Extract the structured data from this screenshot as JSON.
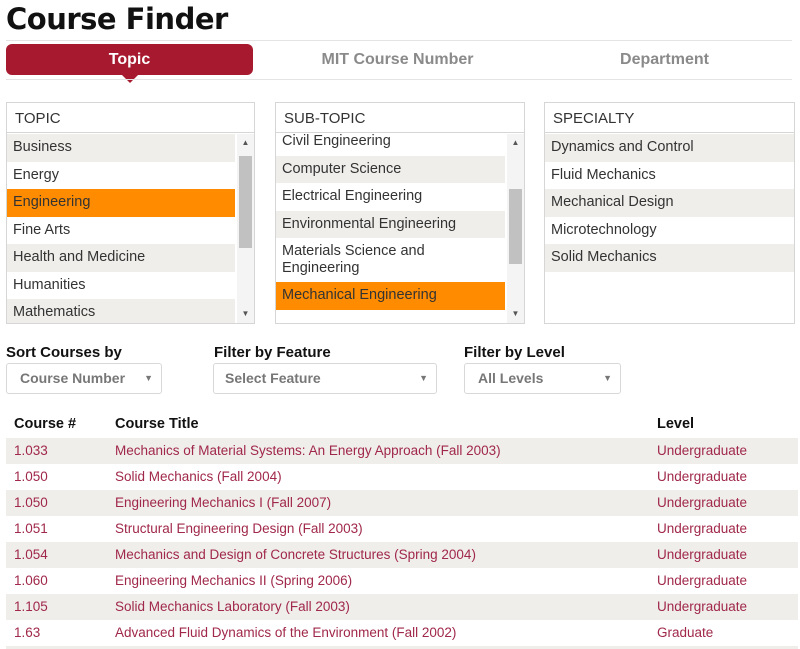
{
  "page": {
    "title": "Course Finder"
  },
  "tabs": [
    {
      "label": "Topic",
      "active": true
    },
    {
      "label": "MIT Course Number",
      "active": false
    },
    {
      "label": "Department",
      "active": false
    }
  ],
  "colors": {
    "accent": "#a6192e",
    "selected": "#ff8c00",
    "link": "#a0284a",
    "alt_row": "#f0eeeb"
  },
  "topic": {
    "header": "TOPIC",
    "items": [
      "Business",
      "Energy",
      "Engineering",
      "Fine Arts",
      "Health and Medicine",
      "Humanities",
      "Mathematics"
    ],
    "selected": "Engineering"
  },
  "subtopic": {
    "header": "SUB-TOPIC",
    "items": [
      "Civil Engineering",
      "Computer Science",
      "Electrical Engineering",
      "Environmental Engineering",
      "Materials Science and Engineering",
      "Mechanical Engineering"
    ],
    "selected": "Mechanical Engineering"
  },
  "specialty": {
    "header": "SPECIALTY",
    "items": [
      "Dynamics and Control",
      "Fluid Mechanics",
      "Mechanical Design",
      "Microtechnology",
      "Solid Mechanics"
    ]
  },
  "filters": {
    "sort": {
      "label": "Sort Courses by",
      "value": "Course Number"
    },
    "feature": {
      "label": "Filter by Feature",
      "value": "Select Feature"
    },
    "level": {
      "label": "Filter by Level",
      "value": "All Levels"
    }
  },
  "icons": {
    "caret": "▼",
    "scroll_up": "▲",
    "scroll_down": "▼"
  },
  "results": {
    "columns": {
      "number": "Course #",
      "title": "Course Title",
      "level": "Level"
    },
    "rows": [
      {
        "number": "1.033",
        "title": "Mechanics of Material Systems: An Energy Approach (Fall 2003)",
        "level": "Undergraduate"
      },
      {
        "number": "1.050",
        "title": "Solid Mechanics (Fall 2004)",
        "level": "Undergraduate"
      },
      {
        "number": "1.050",
        "title": "Engineering Mechanics I (Fall 2007)",
        "level": "Undergraduate"
      },
      {
        "number": "1.051",
        "title": "Structural Engineering Design (Fall 2003)",
        "level": "Undergraduate"
      },
      {
        "number": "1.054",
        "title": "Mechanics and Design of Concrete Structures (Spring 2004)",
        "level": "Undergraduate"
      },
      {
        "number": "1.060",
        "title": "Engineering Mechanics II (Spring 2006)",
        "level": "Undergraduate"
      },
      {
        "number": "1.105",
        "title": "Solid Mechanics Laboratory (Fall 2003)",
        "level": "Undergraduate"
      },
      {
        "number": "1.63",
        "title": "Advanced Fluid Dynamics of the Environment (Fall 2002)",
        "level": "Graduate"
      }
    ]
  }
}
